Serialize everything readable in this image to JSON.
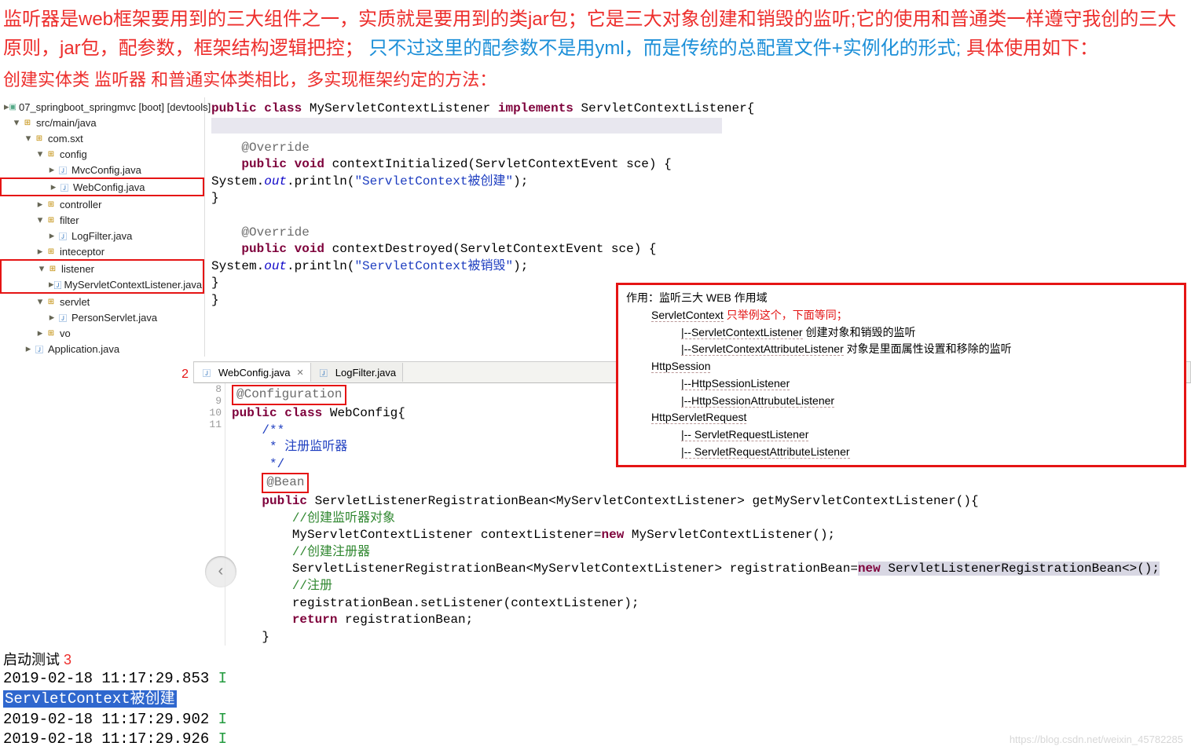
{
  "intro": {
    "red_part": "监听器是web框架要用到的三大组件之一，实质就是要用到的类jar包；它是三大对象创建和销毁的监听;它的使用和普通类一样遵守我创的三大原则，jar包，配参数，框架结构逻辑把控；",
    "blue_part": "只不过这里的配参数不是用yml，而是传统的总配置文件+实例化的形式;",
    "red_tail": "具体使用如下："
  },
  "subheading": "创建实体类 监听器   和普通实体类相比，多实现框架约定的方法：",
  "tree": {
    "proj": "07_springboot_springmvc [boot] [devtools]",
    "srcmain": "src/main/java",
    "pkg": "com.sxt",
    "config": "config",
    "mvccfg": "MvcConfig.java",
    "webcfg": "WebConfig.java",
    "controller": "controller",
    "filter": "filter",
    "logfilter": "LogFilter.java",
    "interceptor": "inteceptor",
    "listener": "listener",
    "mylistener": "MyServletContextListener.java",
    "servlet": "servlet",
    "personservlet": "PersonServlet.java",
    "vo": "vo",
    "appjava": "Application.java"
  },
  "code1": {
    "l1a": "public",
    "l1b": "class",
    "l1c": " MyServletContextListener ",
    "l1d": "implements",
    "l1e": " ServletContextListener{",
    "l3": "@Override",
    "l4a": "public",
    "l4b": "void",
    "l4c": " contextInitialized(ServletContextEvent sce) {",
    "l5a": "        System.",
    "l5b": "out",
    "l5c": ".println(",
    "l5d": "\"ServletContext被创建\"",
    "l5e": ");",
    "l6": "    }",
    "l8": "@Override",
    "l9a": "public",
    "l9b": "void",
    "l9c": " contextDestroyed(ServletContextEvent sce) {",
    "l10a": "        System.",
    "l10b": "out",
    "l10c": ".println(",
    "l10d": "\"ServletContext被销毁\"",
    "l10e": ");",
    "l11": "    }",
    "l12": "}"
  },
  "step2_num": "2",
  "tabs": {
    "t1": "WebConfig.java",
    "t2": "LogFilter.java"
  },
  "gutter": {
    "g8": "8",
    "g9": "9",
    "g10": "10",
    "g11": "11"
  },
  "code2": {
    "conf": "@Configuration",
    "pub": "public",
    "cls": "class",
    "wc": " WebConfig{",
    "cmt1": "/**",
    "cmt2": " * 注册监听器",
    "cmt3": " */",
    "bean": "@Bean",
    "m1a": "public",
    "m1b": " ServletListenerRegistrationBean<MyServletContextListener> getMyServletContextListener(){",
    "c1": "//创建监听器对象",
    "m2a": "MyServletContextListener contextListener=",
    "m2b": "new",
    "m2c": " MyServletContextListener();",
    "c2": "//创建注册器",
    "m3a": "ServletListenerRegistrationBean<MyServletContextListener> registrationBean=",
    "m3b": "new",
    "m3c": " ServletListenerRegistrationBean<>();",
    "c3": "//注册",
    "m4": "registrationBean.setListener(contextListener);",
    "m5a": "return",
    "m5b": " registrationBean;",
    "end": "}"
  },
  "info": {
    "head1": "作用：监听三大 WEB 作用域",
    "sc": "ServletContext",
    "sc_note": "   只举例这个，下面等同；",
    "sc1": "|--ServletContextListener",
    "sc1n": "    创建对象和销毁的监听",
    "sc2": "|--ServletContextAttributeListener",
    "sc2n": "        对象是里面属性设置和移除的监听",
    "hs": "HttpSession",
    "hs1": "|--HttpSessionListener",
    "hs2": "|--HttpSessionAttrubuteListener",
    "hr": "HttpServletRequest",
    "hr1": "|-- ServletRequestListener",
    "hr2": "|-- ServletRequestAttributeListener"
  },
  "launch": {
    "title": "启动测试 ",
    "num": "3"
  },
  "log": {
    "l1": "2019-02-18 11:17:29.853  ",
    "i": "I",
    "sel": "ServletContext被创建",
    "l2": "2019-02-18 11:17:29.902  ",
    "l3": "2019-02-18 11:17:29.926  "
  },
  "watermark": "https://blog.csdn.net/weixin_45782285"
}
